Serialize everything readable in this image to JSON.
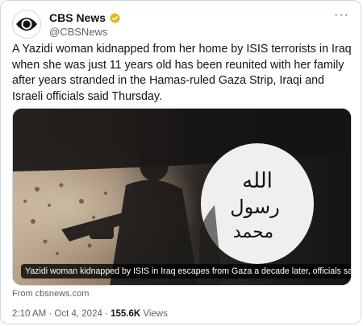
{
  "author": {
    "display_name": "CBS News",
    "handle": "@CBSNews",
    "avatar_icon": "cbs-eye-logo",
    "verified_icon": "gold-verified-badge-icon"
  },
  "more_icon": "more-horizontal-icon",
  "tweet": {
    "text": "A Yazidi woman kidnapped from her home by ISIS terrorists in Iraq when she was just 11 years old has been reunited with her family after years stranded in the Hamas-ruled Gaza Strip, Iraqi and Israeli officials said Thursday."
  },
  "card": {
    "caption": "Yazidi woman kidnapped by ISIS in Iraq escapes from Gaza a decade later, officials say",
    "source": "From cbsnews.com"
  },
  "meta": {
    "timestamp": "2:10 AM · Oct 4, 2024 · ",
    "views_count": "155.6K",
    "views_label": " Views"
  },
  "colors": {
    "text": "#0f1419",
    "secondary": "#536471",
    "border": "#cfd9de",
    "verified_gold": "#e2b719"
  }
}
